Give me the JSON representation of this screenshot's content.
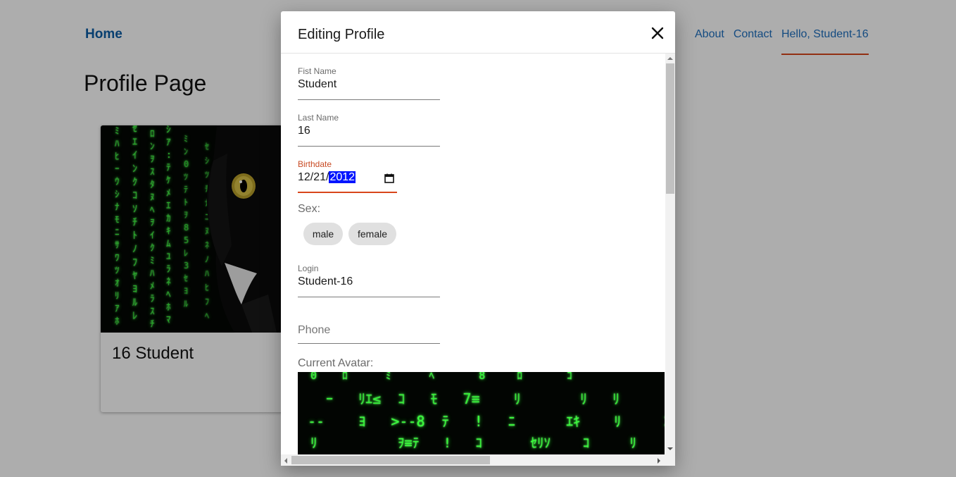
{
  "nav": {
    "home": "Home",
    "links": [
      "About",
      "Contact"
    ],
    "greeting": "Hello, Student-16"
  },
  "page": {
    "title": "Profile Page",
    "card_name": "16 Student"
  },
  "modal": {
    "title": "Editing Profile",
    "close_icon": "close-icon",
    "fields": {
      "first_name": {
        "label": "Fist Name",
        "value": "Student"
      },
      "last_name": {
        "label": "Last Name",
        "value": "16"
      },
      "birthdate": {
        "label": "Birthdate",
        "month_day": "12/21/",
        "year": "2012",
        "icon": "calendar-icon"
      },
      "login": {
        "label": "Login",
        "value": "Student-16"
      },
      "phone": {
        "placeholder": "Phone"
      }
    },
    "sex": {
      "label": "Sex:",
      "options": [
        "male",
        "female"
      ]
    },
    "avatar_label": "Current Avatar:"
  },
  "colors": {
    "accent": "#d8461b",
    "link": "#1e6fbf",
    "home": "#0d5ea5",
    "selection": "#0015ff",
    "matrix_green": "#38ff3a"
  }
}
